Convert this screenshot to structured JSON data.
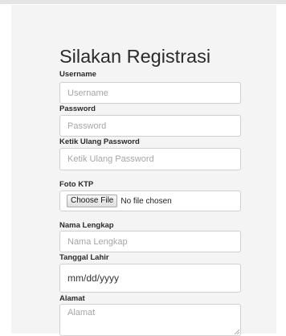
{
  "form": {
    "title": "Silakan Registrasi",
    "username": {
      "label": "Username",
      "placeholder": "Username"
    },
    "password": {
      "label": "Password",
      "placeholder": "Password"
    },
    "confirm_password": {
      "label": "Ketik Ulang Password",
      "placeholder": "Ketik Ulang Password"
    },
    "ktp_photo": {
      "label": "Foto KTP",
      "button": "Choose File",
      "status": "No file chosen"
    },
    "full_name": {
      "label": "Nama Lengkap",
      "placeholder": "Nama Lengkap"
    },
    "birth_date": {
      "label": "Tanggal Lahir",
      "value": "mm/dd/yyyy"
    },
    "address": {
      "label": "Alamat",
      "placeholder": "Alamat"
    }
  },
  "icons": {
    "textarea_corner": "resize-grip-icon"
  },
  "colors": {
    "panel_background": "#f4f4f4",
    "input_border": "#cfcfcf",
    "placeholder_text": "#a6a6a6"
  }
}
